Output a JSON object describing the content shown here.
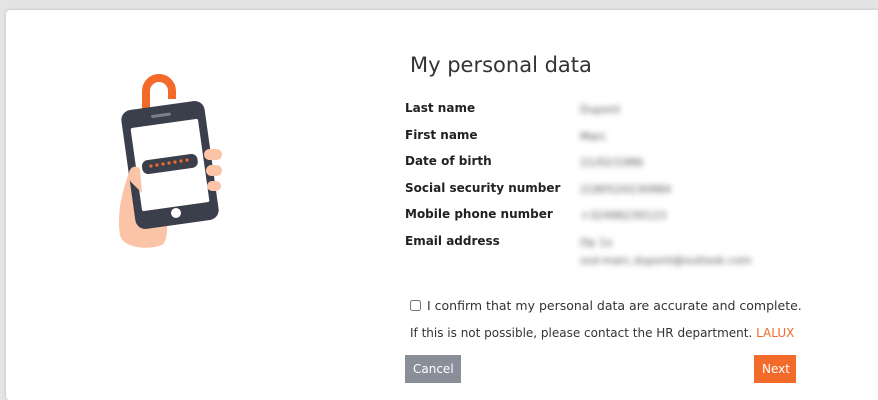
{
  "page": {
    "title": "My personal data"
  },
  "personal_data": [
    {
      "label": "Last name",
      "value": [
        "Dupont"
      ]
    },
    {
      "label": "First name",
      "value": [
        "Marc"
      ]
    },
    {
      "label": "Date of birth",
      "value": [
        "21/02/1986"
      ]
    },
    {
      "label": "Social security number",
      "value": [
        "2180520230984"
      ]
    },
    {
      "label": "Mobile phone number",
      "value": [
        "+32496230123"
      ]
    },
    {
      "label": "Email address",
      "value": [
        "Op 1x",
        "ssd-marc.dupont@outlook.com"
      ]
    }
  ],
  "confirmation": {
    "label": "I confirm that my personal data are accurate and complete.",
    "checked": false
  },
  "contact": {
    "text": "If this is not possible, please contact the HR department.",
    "link_label": "LALUX"
  },
  "buttons": {
    "cancel": "Cancel",
    "next": "Next"
  },
  "colors": {
    "accent": "#f26b2b",
    "cancel_button": "#8a8e99",
    "phone_body": "#3a3f4b",
    "hand": "#fbc4a7"
  },
  "icons": {
    "illustration": "phone-with-padlock-icon"
  }
}
